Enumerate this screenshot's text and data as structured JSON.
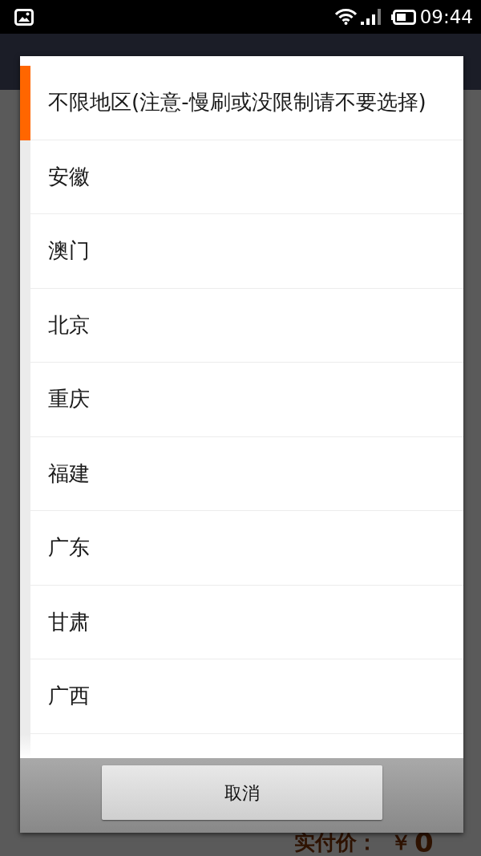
{
  "status_bar": {
    "time": "09:44"
  },
  "dialog": {
    "items": [
      {
        "label": "不限地区(注意-慢刷或没限制请不要选择)",
        "selected": true
      },
      {
        "label": "安徽",
        "selected": false
      },
      {
        "label": "澳门",
        "selected": false
      },
      {
        "label": "北京",
        "selected": false
      },
      {
        "label": "重庆",
        "selected": false
      },
      {
        "label": "福建",
        "selected": false
      },
      {
        "label": "广东",
        "selected": false
      },
      {
        "label": "甘肃",
        "selected": false
      },
      {
        "label": "广西",
        "selected": false
      }
    ],
    "cancel_button": "取消"
  },
  "background": {
    "price_label": "实付价：",
    "currency": "￥",
    "amount": "0"
  }
}
